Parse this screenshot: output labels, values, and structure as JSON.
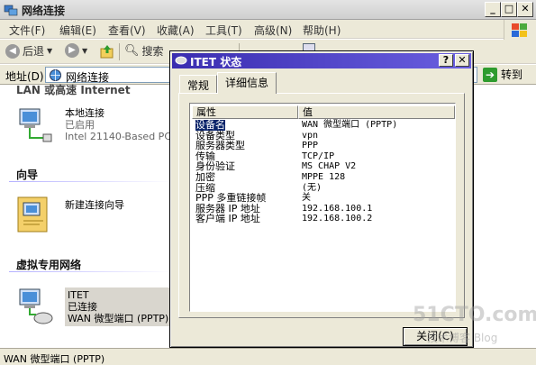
{
  "window": {
    "title": "网络连接",
    "buttons": {
      "minimize": "_",
      "maximize": "□",
      "close": "✕"
    }
  },
  "menu": [
    "文件(F)",
    "编辑(E)",
    "查看(V)",
    "收藏(A)",
    "工具(T)",
    "高级(N)",
    "帮助(H)"
  ],
  "toolbar": {
    "back": "后退",
    "search": "搜索"
  },
  "address": {
    "label": "地址(D)",
    "value": "网络连接",
    "go": "转到"
  },
  "groups": {
    "lan_cut": "LAN 或高速 Internet",
    "wizard": "向导",
    "vpn": "虚拟专用网络"
  },
  "connections": {
    "local": {
      "name": "本地连接",
      "status": "已启用",
      "device": "Intel 21140-Based PCI F"
    },
    "wizard": {
      "name": "新建连接向导"
    },
    "itet": {
      "name": "ITET",
      "status": "已连接",
      "device": "WAN 微型端口 (PPTP)"
    }
  },
  "status_bar": "WAN 微型端口 (PPTP)",
  "dialog": {
    "title": "ITET 状态",
    "help": "?",
    "close_x": "✕",
    "tabs": [
      "常规",
      "详细信息"
    ],
    "columns": [
      "属性",
      "值"
    ],
    "rows": [
      {
        "property": "设备名",
        "value": "WAN 微型端口 (PPTP)"
      },
      {
        "property": "设备类型",
        "value": "vpn"
      },
      {
        "property": "服务器类型",
        "value": "PPP"
      },
      {
        "property": "传输",
        "value": "TCP/IP"
      },
      {
        "property": "身份验证",
        "value": "MS CHAP V2"
      },
      {
        "property": "加密",
        "value": "MPPE 128"
      },
      {
        "property": "压缩",
        "value": "(无)"
      },
      {
        "property": "PPP 多重链接帧",
        "value": "关"
      },
      {
        "property": "服务器 IP 地址",
        "value": "192.168.100.1"
      },
      {
        "property": "客户端 IP 地址",
        "value": "192.168.100.2"
      }
    ],
    "close_button": "关闭(C)"
  },
  "watermark": {
    "line1": "51CTO.com",
    "line2": "技术博客 Blog"
  }
}
